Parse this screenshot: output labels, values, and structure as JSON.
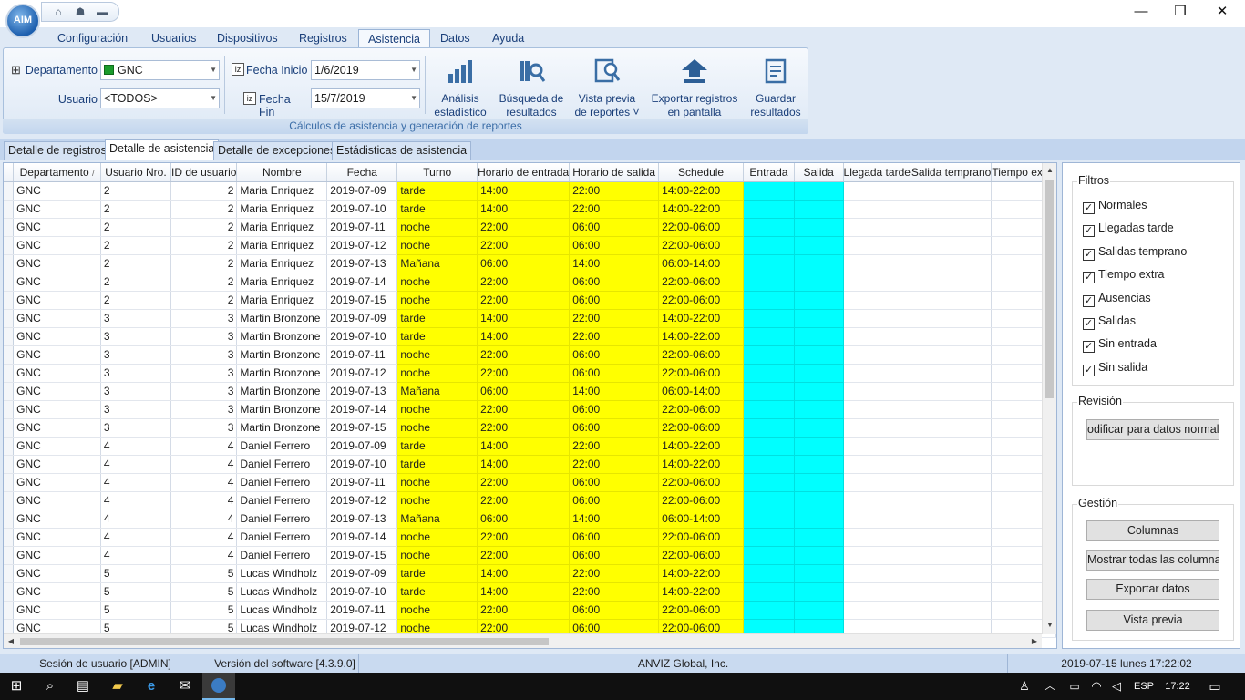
{
  "app": {
    "logo_text": "AIM"
  },
  "quick_access": [
    "home-icon",
    "users-icon",
    "dropdown-icon"
  ],
  "window_controls": {
    "minimize": "—",
    "restore": "❐",
    "close": "✕"
  },
  "menu": [
    "Configuración",
    "Usuarios",
    "Dispositivos",
    "Registros",
    "Asistencia",
    "Datos",
    "Ayuda"
  ],
  "active_menu": "Asistencia",
  "ribbon": {
    "department_label": "Departamento",
    "department_value": "GNC",
    "department_color": "#1a9b2c",
    "user_label": "Usuario",
    "user_value": "<TODOS>",
    "start_label": "Fecha Inicio",
    "start_value": "1/6/2019",
    "end_label": "Fecha Fin",
    "end_value": "15/7/2019",
    "buttons": [
      {
        "line1": "Análisis",
        "line2": "estadístico",
        "icon": "bar-chart-icon"
      },
      {
        "line1": "Búsqueda de",
        "line2": "resultados",
        "icon": "search-books-icon"
      },
      {
        "line1": "Vista previa",
        "line2": "de reportes ˅",
        "icon": "report-preview-icon"
      },
      {
        "line1": "Exportar registros",
        "line2": "en pantalla",
        "icon": "export-arrow-icon"
      },
      {
        "line1": "Guardar",
        "line2": "resultados",
        "icon": "save-results-icon"
      }
    ],
    "group_label": "Cálculos de asistencia y generación de reportes"
  },
  "tabs": [
    "Detalle de registros",
    "Detalle de asistencia",
    "Detalle de excepciones",
    "Estádisticas de asistencia"
  ],
  "active_tab": "Detalle de asistencia",
  "grid": {
    "columns": [
      "Departamento",
      "Usuario Nro.",
      "ID de usuario",
      "Nombre",
      "Fecha",
      "Turno",
      "Horario de entrada",
      "Horario de salida",
      "Schedule",
      "Entrada",
      "Salida",
      "Llegada tarde",
      "Salida temprano",
      "Tiempo extra"
    ],
    "sort_indicator": "↑",
    "rows": [
      [
        "GNC",
        "2",
        "2",
        "Maria Enriquez",
        "2019-07-09",
        "tarde",
        "14:00",
        "22:00",
        "14:00-22:00"
      ],
      [
        "GNC",
        "2",
        "2",
        "Maria Enriquez",
        "2019-07-10",
        "tarde",
        "14:00",
        "22:00",
        "14:00-22:00"
      ],
      [
        "GNC",
        "2",
        "2",
        "Maria Enriquez",
        "2019-07-11",
        "noche",
        "22:00",
        "06:00",
        "22:00-06:00"
      ],
      [
        "GNC",
        "2",
        "2",
        "Maria Enriquez",
        "2019-07-12",
        "noche",
        "22:00",
        "06:00",
        "22:00-06:00"
      ],
      [
        "GNC",
        "2",
        "2",
        "Maria Enriquez",
        "2019-07-13",
        "Mañana",
        "06:00",
        "14:00",
        "06:00-14:00"
      ],
      [
        "GNC",
        "2",
        "2",
        "Maria Enriquez",
        "2019-07-14",
        "noche",
        "22:00",
        "06:00",
        "22:00-06:00"
      ],
      [
        "GNC",
        "2",
        "2",
        "Maria Enriquez",
        "2019-07-15",
        "noche",
        "22:00",
        "06:00",
        "22:00-06:00"
      ],
      [
        "GNC",
        "3",
        "3",
        "Martin Bronzone",
        "2019-07-09",
        "tarde",
        "14:00",
        "22:00",
        "14:00-22:00"
      ],
      [
        "GNC",
        "3",
        "3",
        "Martin Bronzone",
        "2019-07-10",
        "tarde",
        "14:00",
        "22:00",
        "14:00-22:00"
      ],
      [
        "GNC",
        "3",
        "3",
        "Martin Bronzone",
        "2019-07-11",
        "noche",
        "22:00",
        "06:00",
        "22:00-06:00"
      ],
      [
        "GNC",
        "3",
        "3",
        "Martin Bronzone",
        "2019-07-12",
        "noche",
        "22:00",
        "06:00",
        "22:00-06:00"
      ],
      [
        "GNC",
        "3",
        "3",
        "Martin Bronzone",
        "2019-07-13",
        "Mañana",
        "06:00",
        "14:00",
        "06:00-14:00"
      ],
      [
        "GNC",
        "3",
        "3",
        "Martin Bronzone",
        "2019-07-14",
        "noche",
        "22:00",
        "06:00",
        "22:00-06:00"
      ],
      [
        "GNC",
        "3",
        "3",
        "Martin Bronzone",
        "2019-07-15",
        "noche",
        "22:00",
        "06:00",
        "22:00-06:00"
      ],
      [
        "GNC",
        "4",
        "4",
        "Daniel Ferrero",
        "2019-07-09",
        "tarde",
        "14:00",
        "22:00",
        "14:00-22:00"
      ],
      [
        "GNC",
        "4",
        "4",
        "Daniel Ferrero",
        "2019-07-10",
        "tarde",
        "14:00",
        "22:00",
        "14:00-22:00"
      ],
      [
        "GNC",
        "4",
        "4",
        "Daniel Ferrero",
        "2019-07-11",
        "noche",
        "22:00",
        "06:00",
        "22:00-06:00"
      ],
      [
        "GNC",
        "4",
        "4",
        "Daniel Ferrero",
        "2019-07-12",
        "noche",
        "22:00",
        "06:00",
        "22:00-06:00"
      ],
      [
        "GNC",
        "4",
        "4",
        "Daniel Ferrero",
        "2019-07-13",
        "Mañana",
        "06:00",
        "14:00",
        "06:00-14:00"
      ],
      [
        "GNC",
        "4",
        "4",
        "Daniel Ferrero",
        "2019-07-14",
        "noche",
        "22:00",
        "06:00",
        "22:00-06:00"
      ],
      [
        "GNC",
        "4",
        "4",
        "Daniel Ferrero",
        "2019-07-15",
        "noche",
        "22:00",
        "06:00",
        "22:00-06:00"
      ],
      [
        "GNC",
        "5",
        "5",
        "Lucas Windholz",
        "2019-07-09",
        "tarde",
        "14:00",
        "22:00",
        "14:00-22:00"
      ],
      [
        "GNC",
        "5",
        "5",
        "Lucas Windholz",
        "2019-07-10",
        "tarde",
        "14:00",
        "22:00",
        "14:00-22:00"
      ],
      [
        "GNC",
        "5",
        "5",
        "Lucas Windholz",
        "2019-07-11",
        "noche",
        "22:00",
        "06:00",
        "22:00-06:00"
      ],
      [
        "GNC",
        "5",
        "5",
        "Lucas Windholz",
        "2019-07-12",
        "noche",
        "22:00",
        "06:00",
        "22:00-06:00"
      ]
    ],
    "highlight_yellow": "#ffff00",
    "highlight_cyan": "#00ffff"
  },
  "side": {
    "filters_title": "Filtros",
    "filters": [
      "Normales",
      "Llegadas tarde",
      "Salidas temprano",
      "Tiempo extra",
      "Ausencias",
      "Salidas",
      "Sin entrada",
      "Sin salida"
    ],
    "check_mark": "✓",
    "revision_title": "Revisión",
    "revision_button": "odificar para datos normale",
    "gestion_title": "Gestión",
    "gestion_buttons": [
      "Columnas",
      "Mostrar todas las columnas",
      "Exportar datos",
      "Vista previa"
    ]
  },
  "status": {
    "session": "Sesión de usuario  [ADMIN]",
    "version": "Versión del software  [4.3.9.0]",
    "company": "ANVIZ Global, Inc.",
    "datetime": "2019-07-15 lunes 17:22:02"
  },
  "taskbar": {
    "lang": "ESP",
    "time": "17:22"
  }
}
